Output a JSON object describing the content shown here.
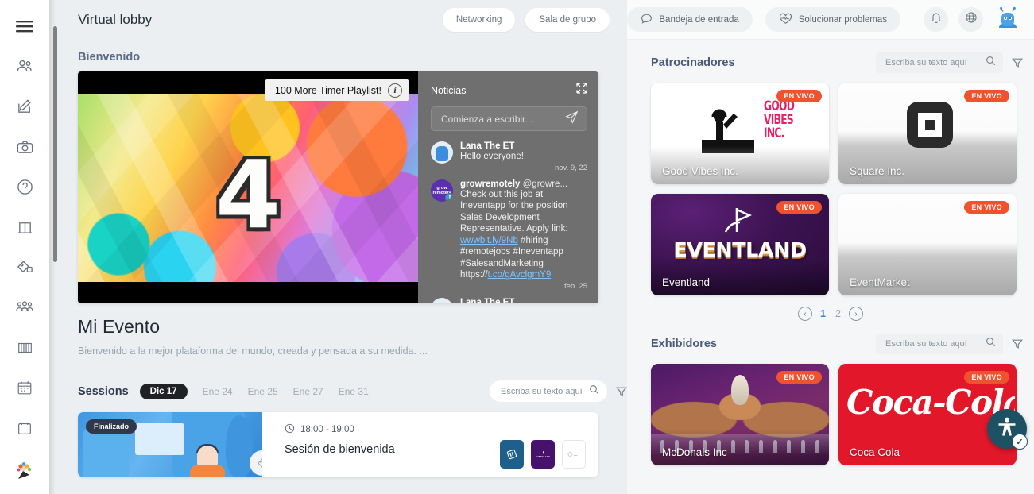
{
  "sidebar": {
    "items": [
      {
        "name": "menu-toggle",
        "icon": "hamburger-icon"
      },
      {
        "name": "attendees",
        "icon": "people-icon"
      },
      {
        "name": "edit",
        "icon": "edit-icon"
      },
      {
        "name": "photos",
        "icon": "camera-icon"
      },
      {
        "name": "help",
        "icon": "question-circle-icon"
      },
      {
        "name": "lobby",
        "icon": "door-icon"
      },
      {
        "name": "tags",
        "icon": "tag-icon"
      },
      {
        "name": "groups",
        "icon": "group-icon"
      },
      {
        "name": "agenda-grid",
        "icon": "grid-icon"
      },
      {
        "name": "calendar",
        "icon": "calendar-icon"
      },
      {
        "name": "schedule",
        "icon": "schedule-icon"
      },
      {
        "name": "celebration",
        "icon": "party-icon"
      }
    ]
  },
  "header": {
    "title": "Virtual lobby",
    "buttons": [
      {
        "label": "Networking",
        "name": "networking-button"
      },
      {
        "label": "Sala de grupo",
        "name": "group-room-button"
      }
    ]
  },
  "welcome": {
    "section_label": "Bienvenido",
    "video": {
      "tooltip": "100 More Timer Playlist!",
      "countdown": "4",
      "info_icon": "info-icon"
    }
  },
  "news": {
    "title": "Noticias",
    "expand_icon": "collapse-icon",
    "compose_placeholder": "Comienza a escribir...",
    "send_icon": "send-icon",
    "posts": [
      {
        "author": "Lana The ET",
        "handle": "",
        "text": "Hello everyone!!",
        "date": "nov. 9, 22",
        "avatar": "lana-avatar"
      },
      {
        "author": "growremotely",
        "handle": "@growre...",
        "text_pre": "Check out this job at Ineventapp for the position Sales Development Representative. Apply link: ",
        "link1": "wwwbit.ly/9Nb",
        "text_mid": " #hiring #remotejobs #Ineventapp #SalesandMarketing https://",
        "link2": "t.co/gAvclgmY9",
        "date": "feb. 25",
        "avatar": "growremotely-avatar",
        "avatar_label": "grow remotely",
        "badge_icon": "twitter-icon"
      },
      {
        "author": "Lana The ET",
        "handle": "",
        "text": "",
        "date": "",
        "avatar": "lana-avatar"
      }
    ]
  },
  "event": {
    "title": "Mi Evento",
    "description": "Bienvenido a la mejor plataforma del mundo, creada y pensada a su medida. ..."
  },
  "sessions": {
    "label": "Sessions",
    "days": [
      {
        "label": "Dic 17",
        "active": true
      },
      {
        "label": "Ene 24",
        "active": false
      },
      {
        "label": "Ene 25",
        "active": false
      },
      {
        "label": "Ene 27",
        "active": false
      },
      {
        "label": "Ene 31",
        "active": false
      }
    ],
    "search_placeholder": "Escriba su texto aquí",
    "search_value": "",
    "search_icon": "search-icon",
    "filter_icon": "filter-icon",
    "list": [
      {
        "status_badge": "Finalizado",
        "time": "18:00 - 19:00",
        "clock_icon": "clock-icon",
        "title": "Sesión de bienvenida",
        "tag_icon": "tag-icon",
        "sponsor_logos": [
          "inevent-logo",
          "eventland-logo",
          "blank-logo"
        ]
      }
    ]
  },
  "topbar": {
    "inbox": {
      "label": "Bandeja de entrada",
      "icon": "chat-bubble-icon"
    },
    "troubleshoot": {
      "label": "Solucionar problemas",
      "icon": "heart-pulse-icon"
    },
    "notifications_icon": "bell-icon",
    "language_icon": "globe-icon",
    "avatar": "user-avatar"
  },
  "sponsors": {
    "title": "Patrocinadores",
    "search_placeholder": "Escriba su texto aquí",
    "search_value": "",
    "search_icon": "search-icon",
    "filter_icon": "filter-icon",
    "live_label": "EN VIVO",
    "items": [
      {
        "name": "Good Vibes Inc.",
        "logo_text": "GOOD VIBES INC.",
        "style": "good-vibes"
      },
      {
        "name": "Square Inc.",
        "logo_text": "",
        "style": "square"
      },
      {
        "name": "Eventland",
        "logo_text": "EVENTLAND",
        "style": "eventland"
      },
      {
        "name": "EventMarket",
        "logo_text": "",
        "style": "placeholder"
      }
    ],
    "pagination": {
      "prev_icon": "chevron-left-icon",
      "next_icon": "chevron-right-icon",
      "pages": [
        "1",
        "2"
      ],
      "current": "1"
    }
  },
  "exhibitors": {
    "title": "Exhibidores",
    "search_placeholder": "Escriba su texto aquí",
    "search_value": "",
    "search_icon": "search-icon",
    "filter_icon": "filter-icon",
    "live_label": "EN VIVO",
    "items": [
      {
        "name": "McDonals Inc",
        "style": "mcdonals"
      },
      {
        "name": "Coca Cola",
        "logo_text": "Coca-Cola",
        "style": "cocacola"
      }
    ]
  },
  "accessibility": {
    "icon": "accessibility-person-icon",
    "check": "✓"
  },
  "colors": {
    "live_badge": "#f0522f",
    "accent_blue": "#2f7fd8",
    "section_heading": "#4a5a78",
    "news_panel": "#6f6f6f",
    "page_bg": "#eceff1"
  }
}
